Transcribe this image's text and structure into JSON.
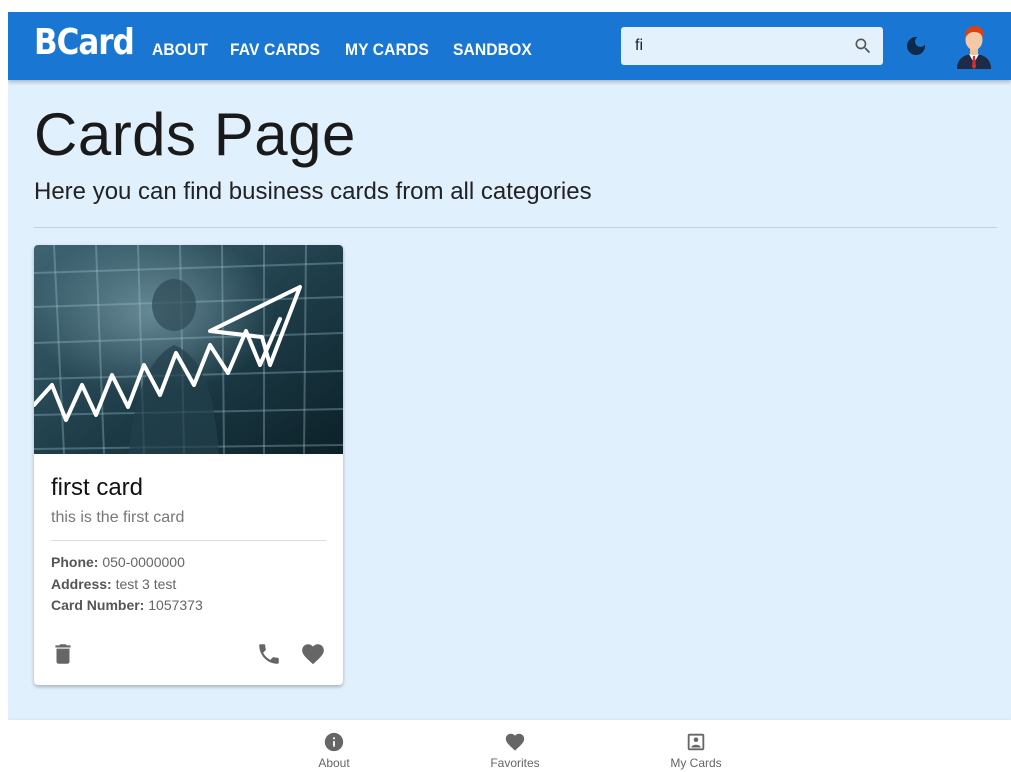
{
  "header": {
    "logo": "BCard",
    "nav": [
      "ABOUT",
      "FAV CARDS",
      "MY CARDS",
      "SANDBOX"
    ],
    "search_value": "fi",
    "brand_color": "#1976d2"
  },
  "icons": {
    "search": "search-icon",
    "mode": "dark-mode-icon",
    "avatar": "user-avatar"
  },
  "page": {
    "title": "Cards Page",
    "subtitle": "Here you can find business cards from all categories",
    "background": "#e1f0fd"
  },
  "cards": [
    {
      "title": "first card",
      "subtitle": "this is the first card",
      "phone_label": "Phone:",
      "phone": "050-0000000",
      "address_label": "Address:",
      "address": "test 3 test",
      "number_label": "Card Number:",
      "number": "1057373",
      "favorite": true
    }
  ],
  "bottom_nav": [
    {
      "label": "About",
      "icon": "info-icon"
    },
    {
      "label": "Favorites",
      "icon": "heart-icon"
    },
    {
      "label": "My Cards",
      "icon": "contact-card-icon"
    }
  ]
}
